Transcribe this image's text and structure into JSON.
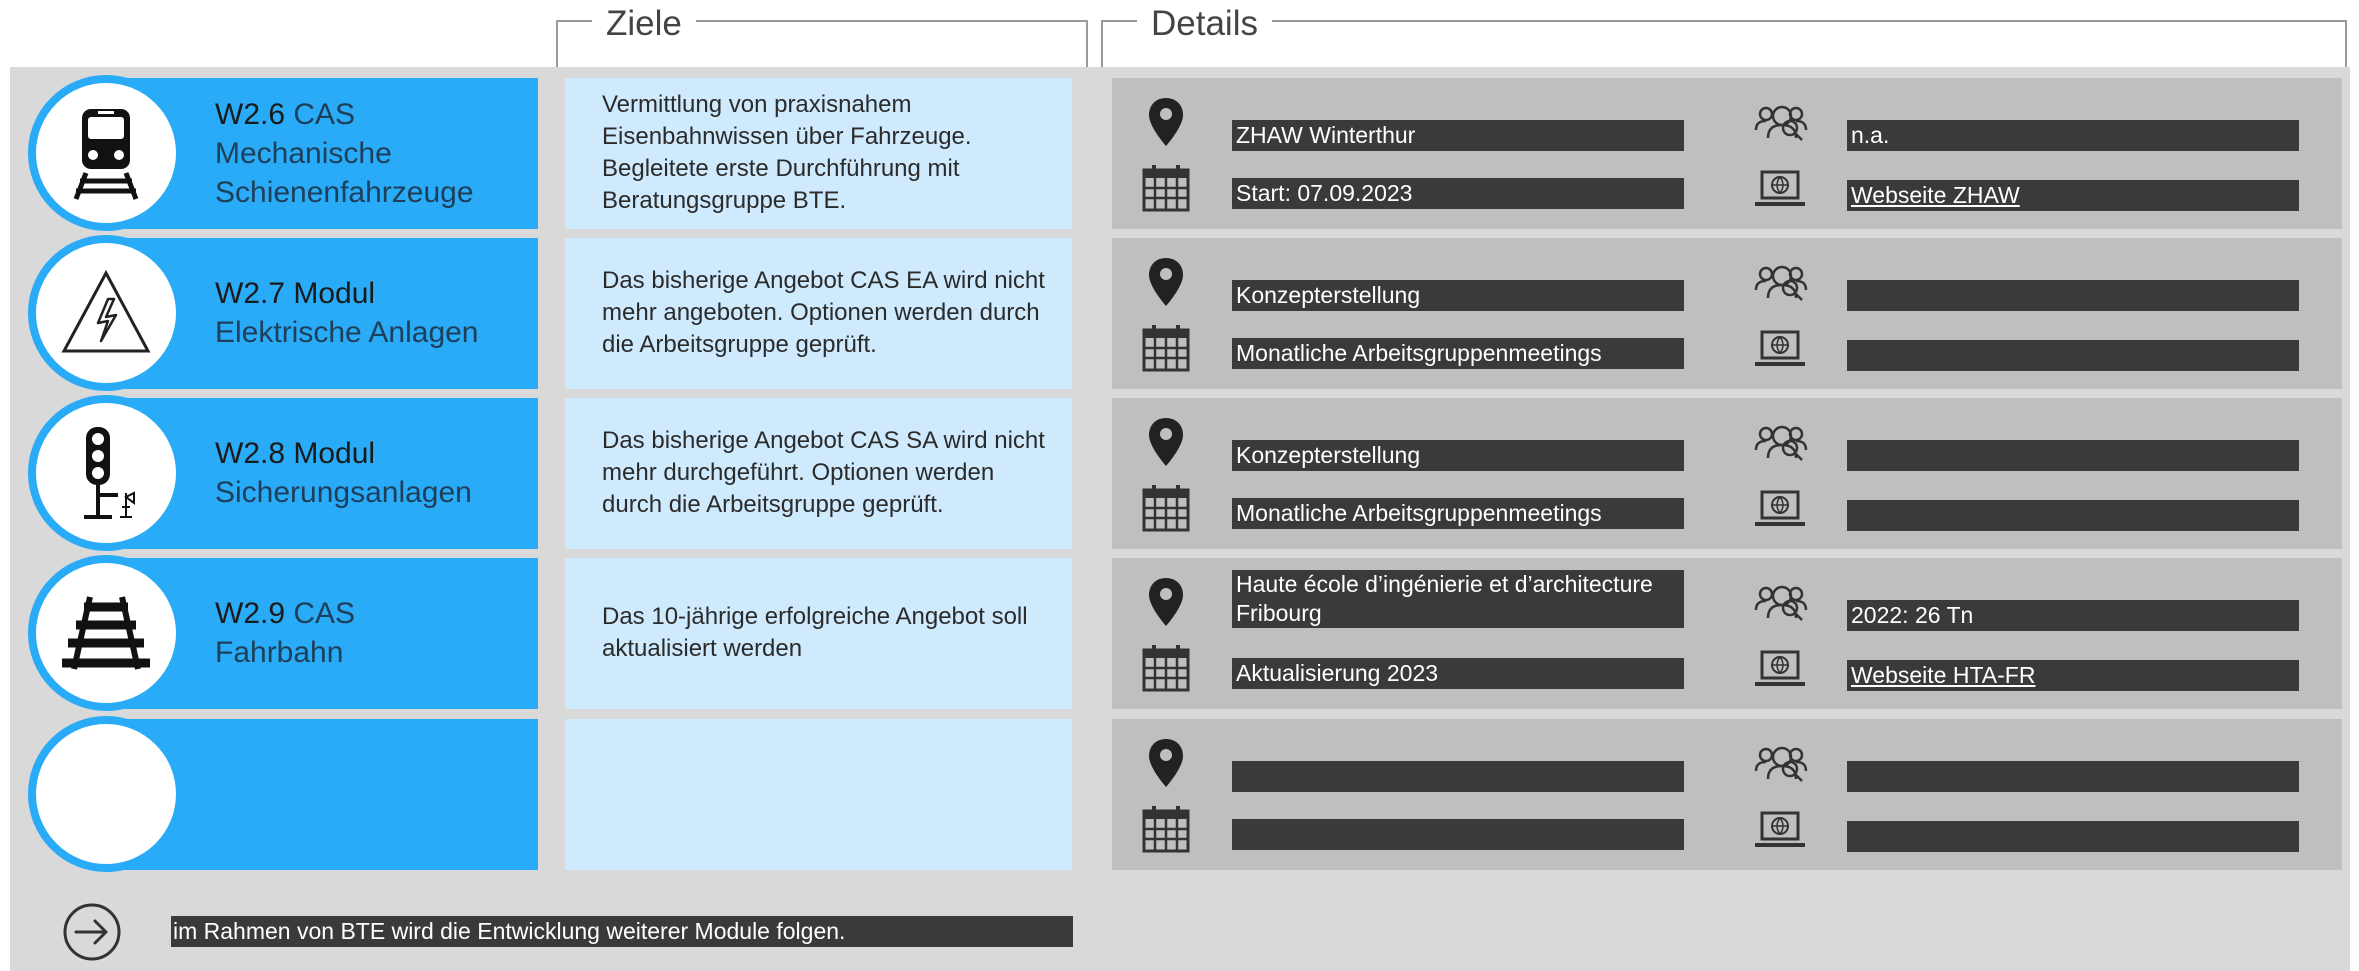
{
  "headers": {
    "ziele": "Ziele",
    "details": "Details"
  },
  "rows": [
    {
      "icon": "train-icon",
      "code": "W2.6",
      "type": " CAS",
      "name_lines": [
        "Mechanische",
        "Schienenfahrzeuge"
      ],
      "ziel": "Vermittlung von praxisnahem Eisenbahnwissen über Fahrzeuge. Begleitete erste Durchführung mit Beratungsgruppe BTE.",
      "location": "ZHAW Winterthur",
      "date": "Start: 07.09.2023",
      "participants": "n.a.",
      "website": "Webseite ZHAW"
    },
    {
      "icon": "electrical-hazard-icon",
      "code": "W2.7 Modul",
      "type": "",
      "name_lines": [
        "Elektrische Anlagen"
      ],
      "ziel": "Das bisherige Angebot CAS EA wird nicht mehr angeboten. Optionen werden durch die Arbeitsgruppe geprüft.",
      "location": "Konzepterstellung",
      "date": "Monatliche Arbeitsgruppenmeetings",
      "participants": "",
      "website": ""
    },
    {
      "icon": "railway-signal-icon",
      "code": "W2.8 Modul",
      "type": "",
      "name_lines": [
        "Sicherungsanlagen"
      ],
      "ziel": "Das bisherige Angebot CAS SA wird nicht mehr durchgeführt. Optionen werden durch die Arbeitsgruppe geprüft.",
      "location": "Konzepterstellung",
      "date": "Monatliche Arbeitsgruppenmeetings",
      "participants": "",
      "website": ""
    },
    {
      "icon": "railway-track-icon",
      "code": "W2.9",
      "type": " CAS",
      "name_lines": [
        "Fahrbahn"
      ],
      "ziel": "Das 10-jährige erfolgreiche Angebot soll aktualisiert werden",
      "location": "Haute école d’ingénierie et d’architecture Fribourg",
      "date": "Aktualisierung 2023",
      "participants": "2022: 26 Tn",
      "website": "Webseite HTA-FR"
    },
    {
      "icon": "",
      "code": "",
      "type": "",
      "name_lines": [],
      "ziel": "",
      "location": "",
      "date": "",
      "participants": "",
      "website": ""
    }
  ],
  "footer": {
    "text": "im Rahmen von BTE wird die Entwicklung weiterer Module folgen."
  },
  "colors": {
    "module_blue": "#29abf8",
    "ziel_blue": "#cfe9fd",
    "detail_grey": "#bfbfbf",
    "bar_dark": "#3a3a3a",
    "panel_grey": "#d9d9d9"
  }
}
